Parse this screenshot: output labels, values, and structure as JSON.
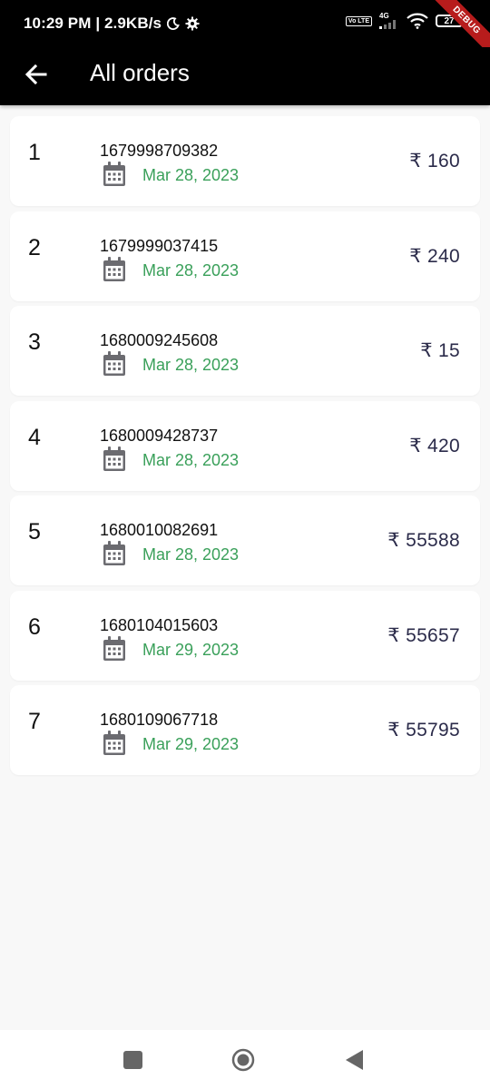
{
  "status_bar": {
    "time_speed": "10:29 PM | 2.9KB/s",
    "volte": "Vo LTE",
    "network": "4G",
    "battery": "27",
    "debug_banner": "DEBUG"
  },
  "app_bar": {
    "title": "All orders",
    "back_icon": "arrow-left-icon"
  },
  "currency_symbol": "₹",
  "orders": [
    {
      "index": "1",
      "order_id": "1679998709382",
      "date": "Mar 28, 2023",
      "amount": "₹ 160"
    },
    {
      "index": "2",
      "order_id": "1679999037415",
      "date": "Mar 28, 2023",
      "amount": "₹ 240"
    },
    {
      "index": "3",
      "order_id": "1680009245608",
      "date": "Mar 28, 2023",
      "amount": "₹ 15"
    },
    {
      "index": "4",
      "order_id": "1680009428737",
      "date": "Mar 28, 2023",
      "amount": "₹ 420"
    },
    {
      "index": "5",
      "order_id": "1680010082691",
      "date": "Mar 28, 2023",
      "amount": "₹ 55588"
    },
    {
      "index": "6",
      "order_id": "1680104015603",
      "date": "Mar 29, 2023",
      "amount": "₹ 55657"
    },
    {
      "index": "7",
      "order_id": "1680109067718",
      "date": "Mar 29, 2023",
      "amount": "₹ 55795"
    }
  ],
  "colors": {
    "app_bar": "#000000",
    "date_text": "#3aa05a",
    "amount_text": "#2b2b4a",
    "calendar_icon": "#6b6b70",
    "debug_ribbon": "#b71c1c"
  },
  "nav_bar": {
    "recent_icon": "square-icon",
    "home_icon": "circle-home-icon",
    "back_icon": "triangle-back-icon"
  }
}
